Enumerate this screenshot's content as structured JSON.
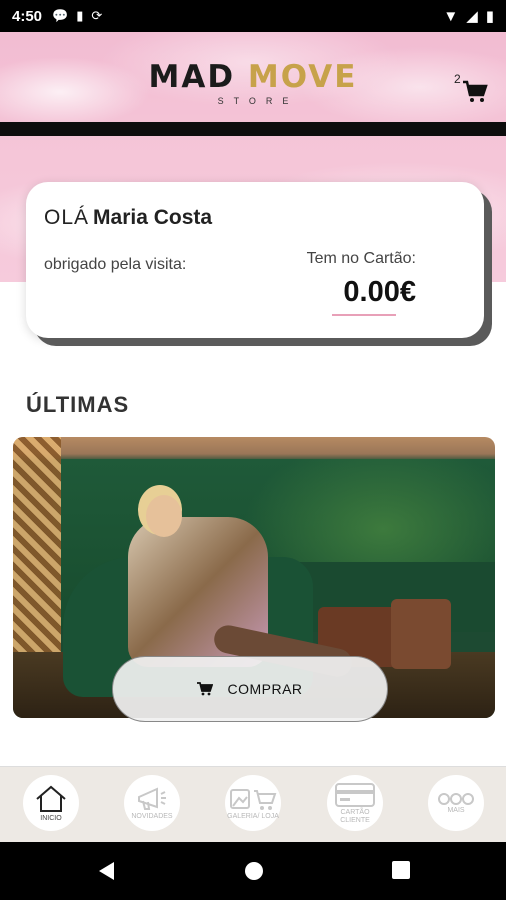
{
  "status_bar": {
    "time": "4:50"
  },
  "header": {
    "brand_part1": "MAD",
    "brand_part2": "MOVE",
    "brand_sub": "STORE",
    "cart_count": "2"
  },
  "card": {
    "hello": "OLÁ",
    "name": "Maria Costa",
    "thanks": "obrigado pela visita:",
    "label": "Tem no Cartão:",
    "balance": "0.00€"
  },
  "section": {
    "title": "ÚLTIMAS"
  },
  "promo": {
    "buy_label": "COMPRAR"
  },
  "nav": {
    "items": [
      {
        "label": "INICIO",
        "icon": "home-icon"
      },
      {
        "label": "NOVIDADES",
        "icon": "megaphone-icon"
      },
      {
        "label": "GALERIA/ LOJA",
        "icon": "gallery-cart-icon"
      },
      {
        "label": "CARTÃO CLIENTE",
        "icon": "card-icon"
      },
      {
        "label": "MAIS",
        "icon": "more-icon"
      }
    ]
  },
  "colors": {
    "brand_gold": "#c7a24a",
    "hero_pink": "#f5c6d8",
    "nav_bg": "#ede9e4"
  }
}
